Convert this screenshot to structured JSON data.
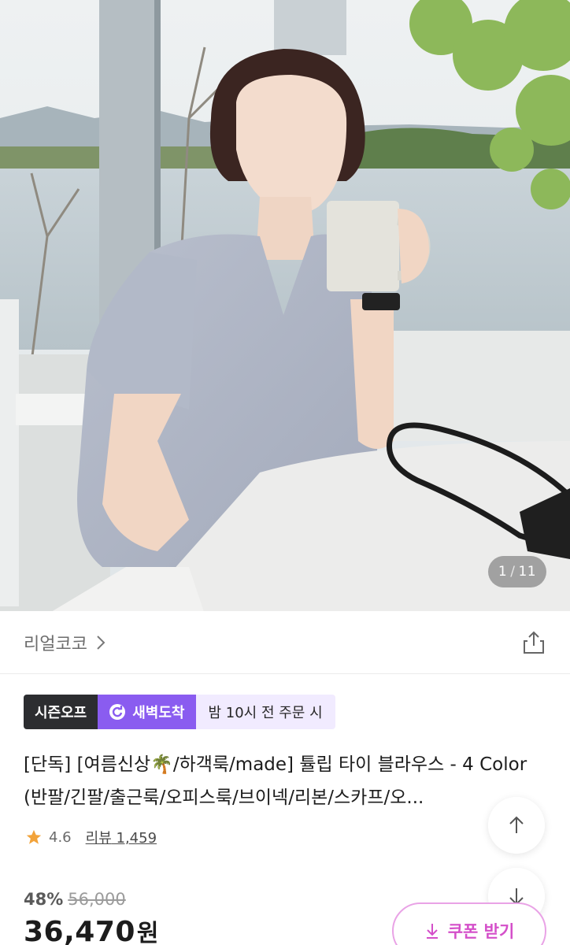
{
  "image": {
    "counter_current": "1",
    "counter_total": "11"
  },
  "brand": {
    "name": "리얼코코"
  },
  "badges": {
    "season": "시즌오프",
    "dawn_delivery": "새벽도착",
    "order_time": "밤 10시 전 주문 시"
  },
  "product": {
    "title": "[단독] [여름신상🌴/하객룩/made] 튤립 타이 블라우스 - 4 Color (반팔/긴팔/출근룩/오피스룩/브이넥/리본/스카프/오..."
  },
  "rating": {
    "score": "4.6",
    "review_label": "리뷰",
    "review_count": "1,459"
  },
  "price": {
    "discount_rate": "48%",
    "original": "56,000",
    "current": "36,470",
    "unit": "원"
  },
  "coupon": {
    "label": "쿠폰 받기"
  },
  "colors": {
    "accent_purple": "#8a5cf0",
    "coupon_pink": "#d44fc9",
    "star": "#f2a33a"
  },
  "icons": {
    "brand_chevron": "chevron-right-icon",
    "share": "share-icon",
    "dawn": "refresh-arrow-icon",
    "star": "star-icon",
    "coupon": "download-arrow-icon",
    "scroll_up": "arrow-up-icon",
    "scroll_down": "arrow-down-icon"
  }
}
